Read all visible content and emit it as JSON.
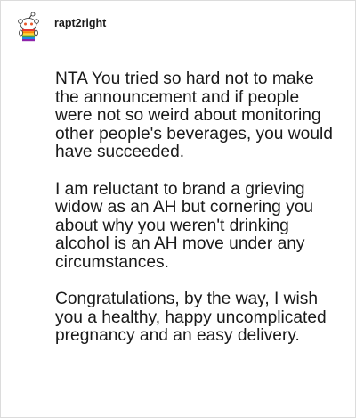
{
  "post": {
    "author": "rapt2right",
    "avatar_icon": "reddit-snoo-avatar-icon",
    "paragraphs": [
      "NTA You tried so hard not to make the announcement and if people were not so weird about monitoring other people's beverages, you would have succeeded.",
      "I am reluctant to brand a grieving widow as an AH but cornering you about why you weren't drinking alcohol is an AH move under any circumstances.",
      "Congratulations, by the way, I wish you a healthy, happy uncomplicated pregnancy and an easy delivery."
    ]
  },
  "colors": {
    "border": "#dcdcdc",
    "text": "#1a1a1a",
    "background": "#ffffff"
  }
}
